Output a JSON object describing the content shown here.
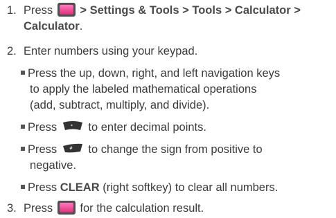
{
  "steps": [
    {
      "number": "1.",
      "press": "Press",
      "path": "> Settings & Tools > Tools > Calculator >",
      "path_end": "Calculator",
      "period": "."
    },
    {
      "number": "2.",
      "text": "Enter numbers using your keypad."
    },
    {
      "number": "3.",
      "press": "Press",
      "text": "for the calculation result."
    }
  ],
  "bullets": {
    "nav_line1": "Press the up, down, right, and left navigation keys",
    "nav_line2": "to apply the labeled mathematical operations",
    "nav_line3": "(add, subtract, multiply, and divide).",
    "decimal_press": "Press",
    "decimal_text": "to enter decimal points.",
    "sign_press": "Press",
    "sign_text": "to change the sign from positive to",
    "sign_cont": "negative.",
    "clear_press": "Press",
    "clear_label": "CLEAR",
    "clear_text": "(right softkey) to clear all numbers."
  },
  "icons": {
    "menu_key": "menu-key-icon",
    "star_key": "star-key-icon",
    "pound_key": "pound-key-icon"
  }
}
